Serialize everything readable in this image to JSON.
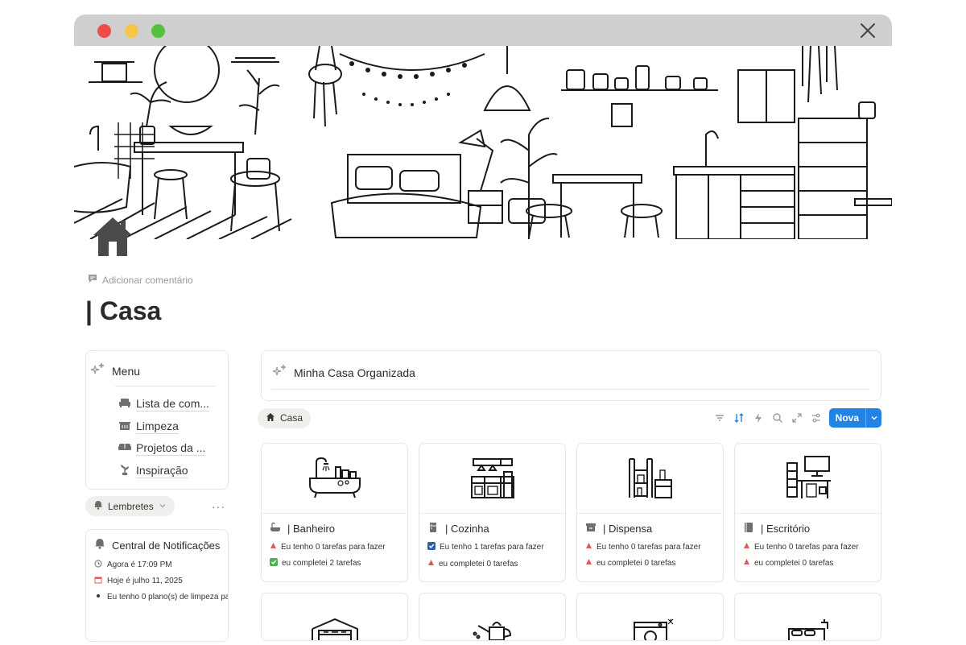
{
  "page": {
    "add_comment": "Adicionar comentário",
    "title": "| Casa"
  },
  "menu": {
    "title": "Menu",
    "items": [
      {
        "label": "Lista de com...",
        "icon": "sofa-icon"
      },
      {
        "label": "Limpeza",
        "icon": "basket-icon"
      },
      {
        "label": "Projetos da ...",
        "icon": "couch-icon"
      },
      {
        "label": "Inspiração",
        "icon": "plant-icon"
      }
    ]
  },
  "reminders": {
    "label": "Lembretes",
    "more": "···"
  },
  "notifications": {
    "title": "Central de Notificações",
    "lines": [
      {
        "text": "Agora é 17:09 PM",
        "icon": "clock-icon"
      },
      {
        "text": "Hoje é julho 11, 2025",
        "icon": "calendar-icon"
      },
      {
        "text": "Eu tenho 0 plano(s) de limpeza pa",
        "icon": "bullet-icon"
      }
    ]
  },
  "main": {
    "title": "Minha Casa Organizada",
    "tab": "Casa",
    "new_button": "Nova"
  },
  "rooms": [
    {
      "name": "| Banheiro",
      "icon": "bathtub-icon",
      "todo": "Eu tenho 0 tarefas para fazer",
      "todo_check": false,
      "done": "eu completei 2 tarefas",
      "done_check": true
    },
    {
      "name": "| Cozinha",
      "icon": "fridge-icon",
      "todo": "Eu tenho 1 tarefas para fazer",
      "todo_check": true,
      "done": "eu completei 0 tarefas",
      "done_check": false
    },
    {
      "name": "| Dispensa",
      "icon": "pantry-box-icon",
      "todo": "Eu tenho 0 tarefas para fazer",
      "todo_check": false,
      "done": "eu completei 0 tarefas",
      "done_check": false
    },
    {
      "name": "| Escritório",
      "icon": "book-icon",
      "todo": "Eu tenho 0 tarefas para fazer",
      "todo_check": false,
      "done": "eu completei 0 tarefas",
      "done_check": false
    }
  ],
  "colors": {
    "accent": "#2383e2",
    "warning": "#e05a5a",
    "check": "#2e8b57"
  }
}
